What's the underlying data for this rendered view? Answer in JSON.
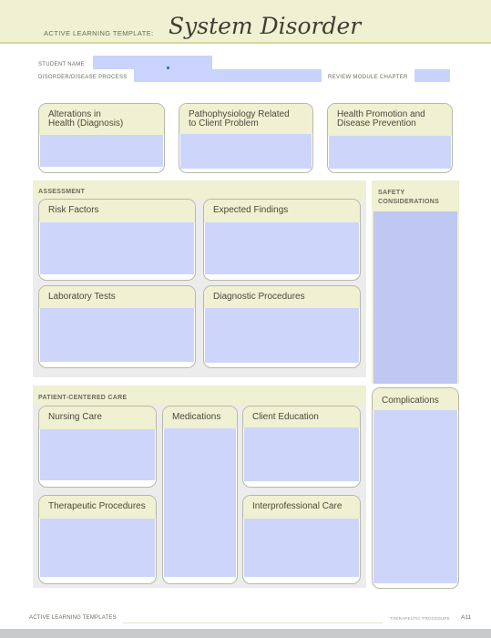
{
  "header": {
    "template_label": "ACTIVE LEARNING TEMPLATE:",
    "title": "System Disorder"
  },
  "fields": {
    "student_name": {
      "label": "STUDENT NAME",
      "value": ""
    },
    "disorder_process": {
      "label": "DISORDER/DISEASE PROCESS",
      "value": ""
    },
    "review_module_chapter": {
      "label": "REVIEW MODULE CHAPTER",
      "value": ""
    }
  },
  "top_cards": [
    {
      "title_line1": "Alterations in",
      "title_line2": "Health (Diagnosis)",
      "value": ""
    },
    {
      "title_line1": "Pathophysiology Related",
      "title_line2": "to Client Problem",
      "value": ""
    },
    {
      "title_line1": "Health Promotion and",
      "title_line2": "Disease Prevention",
      "value": ""
    }
  ],
  "assessment": {
    "title": "ASSESSMENT",
    "cards": [
      {
        "title": "Risk Factors",
        "value": ""
      },
      {
        "title": "Expected Findings",
        "value": ""
      },
      {
        "title": "Laboratory Tests",
        "value": ""
      },
      {
        "title": "Diagnostic Procedures",
        "value": ""
      }
    ]
  },
  "safety": {
    "title_line1": "SAFETY",
    "title_line2": "CONSIDERATIONS",
    "value": ""
  },
  "patient_care": {
    "title": "PATIENT-CENTERED CARE",
    "cards": [
      {
        "title": "Nursing Care",
        "value": ""
      },
      {
        "title": "Medications",
        "value": ""
      },
      {
        "title": "Client Education",
        "value": ""
      },
      {
        "title": "Therapeutic Procedures",
        "value": ""
      },
      {
        "title": "Interprofessional Care",
        "value": ""
      }
    ]
  },
  "complications": {
    "title": "Complications",
    "value": ""
  },
  "footer": {
    "left": "ACTIVE LEARNING TEMPLATES",
    "right": "THERAPEUTIC PROCEDURE",
    "page": "A11"
  },
  "colors": {
    "header_band": "#f0f0d2",
    "field_fill": "#c9d3fb",
    "section_bg": "#ececec",
    "card_border": "#b8b8a8"
  }
}
